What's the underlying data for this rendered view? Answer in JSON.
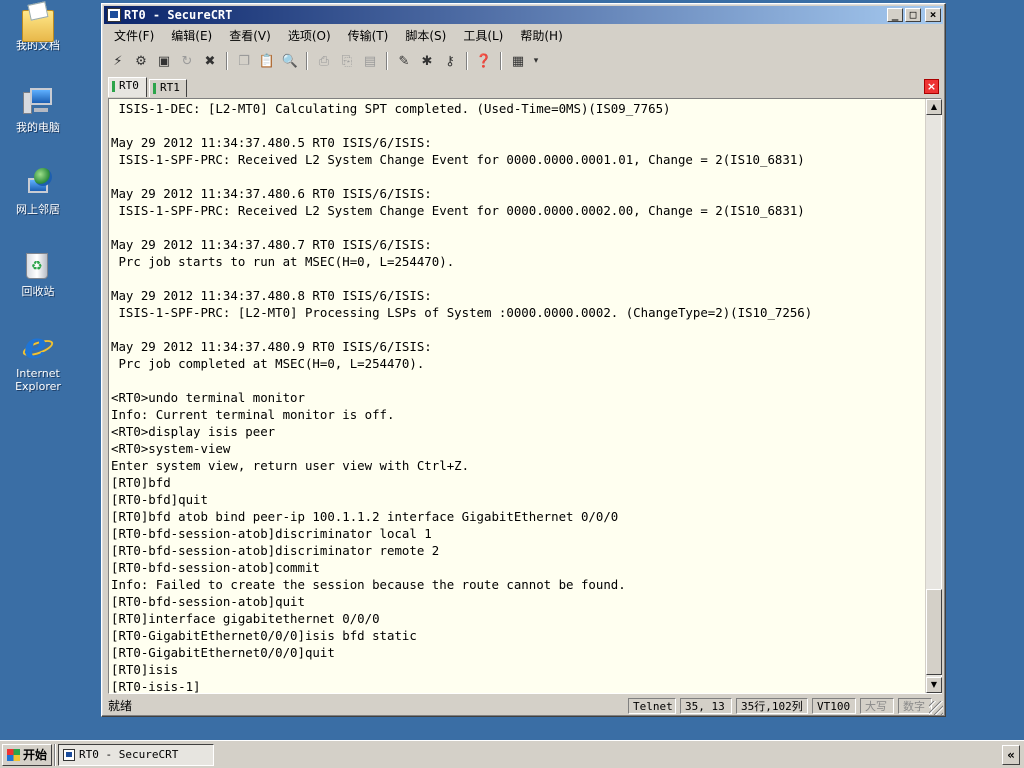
{
  "desktop": {
    "icons": [
      {
        "label": "我的文档",
        "icon": "my-documents-icon"
      },
      {
        "label": "我的电脑",
        "icon": "my-computer-icon"
      },
      {
        "label": "网上邻居",
        "icon": "network-places-icon"
      },
      {
        "label": "回收站",
        "icon": "recycle-bin-icon"
      },
      {
        "label_line1": "Internet",
        "label_line2": "Explorer",
        "icon": "internet-explorer-icon"
      }
    ]
  },
  "window": {
    "title": "RT0 - SecureCRT",
    "controls": {
      "minimize": "_",
      "maximize": "□",
      "close": "×"
    }
  },
  "menu": [
    "文件(F)",
    "编辑(E)",
    "查看(V)",
    "选项(O)",
    "传输(T)",
    "脚本(S)",
    "工具(L)",
    "帮助(H)"
  ],
  "tabs": [
    {
      "label": "RT0",
      "active": true
    },
    {
      "label": "RT1",
      "active": false
    }
  ],
  "terminal": {
    "lines": [
      " ISIS-1-DEC: [L2-MT0] Calculating SPT completed. (Used-Time=0MS)(IS09_7765)",
      "",
      "May 29 2012 11:34:37.480.5 RT0 ISIS/6/ISIS:",
      " ISIS-1-SPF-PRC: Received L2 System Change Event for 0000.0000.0001.01, Change = 2(IS10_6831)",
      "",
      "May 29 2012 11:34:37.480.6 RT0 ISIS/6/ISIS:",
      " ISIS-1-SPF-PRC: Received L2 System Change Event for 0000.0000.0002.00, Change = 2(IS10_6831)",
      "",
      "May 29 2012 11:34:37.480.7 RT0 ISIS/6/ISIS:",
      " Prc job starts to run at MSEC(H=0, L=254470).",
      "",
      "May 29 2012 11:34:37.480.8 RT0 ISIS/6/ISIS:",
      " ISIS-1-SPF-PRC: [L2-MT0] Processing LSPs of System :0000.0000.0002. (ChangeType=2)(IS10_7256)",
      "",
      "May 29 2012 11:34:37.480.9 RT0 ISIS/6/ISIS:",
      " Prc job completed at MSEC(H=0, L=254470).",
      "",
      "<RT0>undo terminal monitor",
      "Info: Current terminal monitor is off.",
      "<RT0>display isis peer",
      "<RT0>system-view",
      "Enter system view, return user view with Ctrl+Z.",
      "[RT0]bfd",
      "[RT0-bfd]quit",
      "[RT0]bfd atob bind peer-ip 100.1.1.2 interface GigabitEthernet 0/0/0",
      "[RT0-bfd-session-atob]discriminator local 1",
      "[RT0-bfd-session-atob]discriminator remote 2",
      "[RT0-bfd-session-atob]commit",
      "Info: Failed to create the session because the route cannot be found.",
      "[RT0-bfd-session-atob]quit",
      "[RT0]interface gigabitethernet 0/0/0",
      "[RT0-GigabitEthernet0/0/0]isis bfd static",
      "[RT0-GigabitEthernet0/0/0]quit",
      "[RT0]isis",
      "[RT0-isis-1]"
    ]
  },
  "status": {
    "ready": "就绪",
    "protocol": "Telnet",
    "cursor": "35,  13",
    "size": "35行,102列",
    "emulation": "VT100",
    "caps": "大写",
    "num": "数字"
  },
  "taskbar": {
    "start": "开始",
    "task": "RT0 - SecureCRT",
    "tray": "«"
  },
  "colors": {
    "desktop": "#3a6ea5",
    "terminal_bg": "#fffff0",
    "title_start": "#0a246a",
    "title_end": "#a6caf0"
  }
}
